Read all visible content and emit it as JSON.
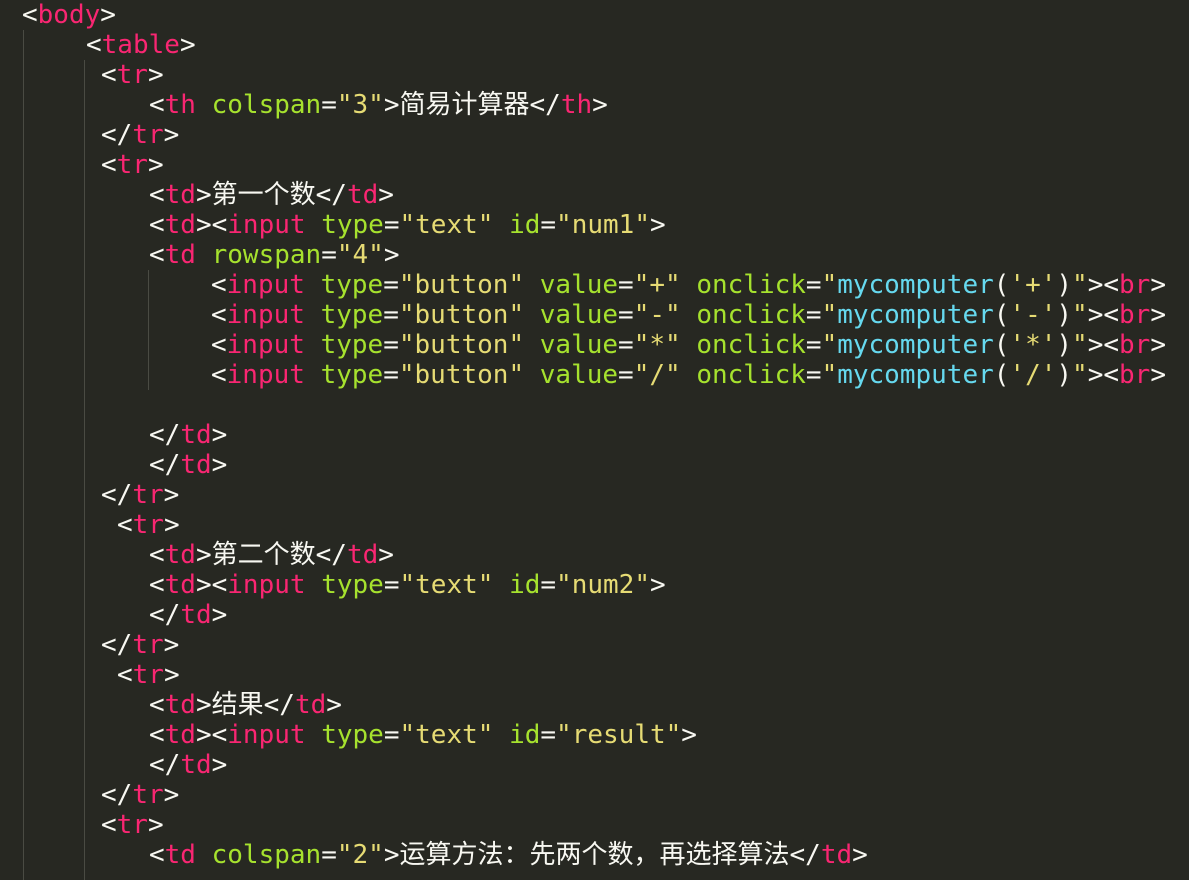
{
  "editor": {
    "colors": {
      "background": "#272822",
      "tag": "#f92672",
      "attribute": "#a6e22e",
      "string": "#e6db74",
      "function": "#66d9ef",
      "punctuation": "#f8f8f2"
    },
    "lines": [
      {
        "tokens": [
          {
            "k": "p",
            "v": "<"
          },
          {
            "k": "t",
            "v": "body"
          },
          {
            "k": "p",
            "v": ">"
          }
        ]
      },
      {
        "tokens": [
          {
            "k": "p",
            "v": "<"
          },
          {
            "k": "t",
            "v": "table"
          },
          {
            "k": "p",
            "v": ">"
          }
        ]
      },
      {
        "tokens": [
          {
            "k": "p",
            "v": "<"
          },
          {
            "k": "t",
            "v": "tr"
          },
          {
            "k": "p",
            "v": ">"
          }
        ]
      },
      {
        "tokens": [
          {
            "k": "p",
            "v": "<"
          },
          {
            "k": "t",
            "v": "th"
          },
          {
            "k": "p",
            "v": " "
          },
          {
            "k": "a",
            "v": "colspan"
          },
          {
            "k": "p",
            "v": "="
          },
          {
            "k": "s",
            "v": "\"3\""
          },
          {
            "k": "p",
            "v": ">"
          },
          {
            "k": "x",
            "v": "简易计算器"
          },
          {
            "k": "p",
            "v": "</"
          },
          {
            "k": "t",
            "v": "th"
          },
          {
            "k": "p",
            "v": ">"
          }
        ]
      },
      {
        "tokens": [
          {
            "k": "p",
            "v": "</"
          },
          {
            "k": "t",
            "v": "tr"
          },
          {
            "k": "p",
            "v": ">"
          }
        ]
      },
      {
        "tokens": [
          {
            "k": "p",
            "v": "<"
          },
          {
            "k": "t",
            "v": "tr"
          },
          {
            "k": "p",
            "v": ">"
          }
        ]
      },
      {
        "tokens": [
          {
            "k": "p",
            "v": "<"
          },
          {
            "k": "t",
            "v": "td"
          },
          {
            "k": "p",
            "v": ">"
          },
          {
            "k": "x",
            "v": "第一个数"
          },
          {
            "k": "p",
            "v": "</"
          },
          {
            "k": "t",
            "v": "td"
          },
          {
            "k": "p",
            "v": ">"
          }
        ]
      },
      {
        "tokens": [
          {
            "k": "p",
            "v": "<"
          },
          {
            "k": "t",
            "v": "td"
          },
          {
            "k": "p",
            "v": "><"
          },
          {
            "k": "t",
            "v": "input"
          },
          {
            "k": "p",
            "v": " "
          },
          {
            "k": "a",
            "v": "type"
          },
          {
            "k": "p",
            "v": "="
          },
          {
            "k": "s",
            "v": "\"text\""
          },
          {
            "k": "p",
            "v": " "
          },
          {
            "k": "a",
            "v": "id"
          },
          {
            "k": "p",
            "v": "="
          },
          {
            "k": "s",
            "v": "\"num1\""
          },
          {
            "k": "p",
            "v": ">"
          }
        ]
      },
      {
        "tokens": [
          {
            "k": "p",
            "v": "<"
          },
          {
            "k": "t",
            "v": "td"
          },
          {
            "k": "p",
            "v": " "
          },
          {
            "k": "a",
            "v": "rowspan"
          },
          {
            "k": "p",
            "v": "="
          },
          {
            "k": "s",
            "v": "\"4\""
          },
          {
            "k": "p",
            "v": ">"
          }
        ]
      },
      {
        "tokens": [
          {
            "k": "p",
            "v": "<"
          },
          {
            "k": "t",
            "v": "input"
          },
          {
            "k": "p",
            "v": " "
          },
          {
            "k": "a",
            "v": "type"
          },
          {
            "k": "p",
            "v": "="
          },
          {
            "k": "s",
            "v": "\"button\""
          },
          {
            "k": "p",
            "v": " "
          },
          {
            "k": "a",
            "v": "value"
          },
          {
            "k": "p",
            "v": "="
          },
          {
            "k": "s",
            "v": "\"+\""
          },
          {
            "k": "p",
            "v": " "
          },
          {
            "k": "a",
            "v": "onclick"
          },
          {
            "k": "p",
            "v": "="
          },
          {
            "k": "s",
            "v": "\""
          },
          {
            "k": "f",
            "v": "mycomputer"
          },
          {
            "k": "p",
            "v": "("
          },
          {
            "k": "s",
            "v": "'+'"
          },
          {
            "k": "p",
            "v": ")"
          },
          {
            "k": "s",
            "v": "\""
          },
          {
            "k": "p",
            "v": "><"
          },
          {
            "k": "t",
            "v": "br"
          },
          {
            "k": "p",
            "v": ">"
          }
        ]
      },
      {
        "tokens": [
          {
            "k": "p",
            "v": "<"
          },
          {
            "k": "t",
            "v": "input"
          },
          {
            "k": "p",
            "v": " "
          },
          {
            "k": "a",
            "v": "type"
          },
          {
            "k": "p",
            "v": "="
          },
          {
            "k": "s",
            "v": "\"button\""
          },
          {
            "k": "p",
            "v": " "
          },
          {
            "k": "a",
            "v": "value"
          },
          {
            "k": "p",
            "v": "="
          },
          {
            "k": "s",
            "v": "\"-\""
          },
          {
            "k": "p",
            "v": " "
          },
          {
            "k": "a",
            "v": "onclick"
          },
          {
            "k": "p",
            "v": "="
          },
          {
            "k": "s",
            "v": "\""
          },
          {
            "k": "f",
            "v": "mycomputer"
          },
          {
            "k": "p",
            "v": "("
          },
          {
            "k": "s",
            "v": "'-'"
          },
          {
            "k": "p",
            "v": ")"
          },
          {
            "k": "s",
            "v": "\""
          },
          {
            "k": "p",
            "v": "><"
          },
          {
            "k": "t",
            "v": "br"
          },
          {
            "k": "p",
            "v": ">"
          }
        ]
      },
      {
        "tokens": [
          {
            "k": "p",
            "v": "<"
          },
          {
            "k": "t",
            "v": "input"
          },
          {
            "k": "p",
            "v": " "
          },
          {
            "k": "a",
            "v": "type"
          },
          {
            "k": "p",
            "v": "="
          },
          {
            "k": "s",
            "v": "\"button\""
          },
          {
            "k": "p",
            "v": " "
          },
          {
            "k": "a",
            "v": "value"
          },
          {
            "k": "p",
            "v": "="
          },
          {
            "k": "s",
            "v": "\"*\""
          },
          {
            "k": "p",
            "v": " "
          },
          {
            "k": "a",
            "v": "onclick"
          },
          {
            "k": "p",
            "v": "="
          },
          {
            "k": "s",
            "v": "\""
          },
          {
            "k": "f",
            "v": "mycomputer"
          },
          {
            "k": "p",
            "v": "("
          },
          {
            "k": "s",
            "v": "'*'"
          },
          {
            "k": "p",
            "v": ")"
          },
          {
            "k": "s",
            "v": "\""
          },
          {
            "k": "p",
            "v": "><"
          },
          {
            "k": "t",
            "v": "br"
          },
          {
            "k": "p",
            "v": ">"
          }
        ]
      },
      {
        "tokens": [
          {
            "k": "p",
            "v": "<"
          },
          {
            "k": "t",
            "v": "input"
          },
          {
            "k": "p",
            "v": " "
          },
          {
            "k": "a",
            "v": "type"
          },
          {
            "k": "p",
            "v": "="
          },
          {
            "k": "s",
            "v": "\"button\""
          },
          {
            "k": "p",
            "v": " "
          },
          {
            "k": "a",
            "v": "value"
          },
          {
            "k": "p",
            "v": "="
          },
          {
            "k": "s",
            "v": "\"/\""
          },
          {
            "k": "p",
            "v": " "
          },
          {
            "k": "a",
            "v": "onclick"
          },
          {
            "k": "p",
            "v": "="
          },
          {
            "k": "s",
            "v": "\""
          },
          {
            "k": "f",
            "v": "mycomputer"
          },
          {
            "k": "p",
            "v": "("
          },
          {
            "k": "s",
            "v": "'/'"
          },
          {
            "k": "p",
            "v": ")"
          },
          {
            "k": "s",
            "v": "\""
          },
          {
            "k": "p",
            "v": "><"
          },
          {
            "k": "t",
            "v": "br"
          },
          {
            "k": "p",
            "v": ">"
          }
        ]
      },
      {
        "tokens": []
      },
      {
        "tokens": [
          {
            "k": "p",
            "v": "</"
          },
          {
            "k": "t",
            "v": "td"
          },
          {
            "k": "p",
            "v": ">"
          }
        ]
      },
      {
        "tokens": [
          {
            "k": "p",
            "v": "</"
          },
          {
            "k": "t",
            "v": "td"
          },
          {
            "k": "p",
            "v": ">"
          }
        ]
      },
      {
        "tokens": [
          {
            "k": "p",
            "v": "</"
          },
          {
            "k": "t",
            "v": "tr"
          },
          {
            "k": "p",
            "v": ">"
          }
        ]
      },
      {
        "tokens": [
          {
            "k": "p",
            "v": "<"
          },
          {
            "k": "t",
            "v": "tr"
          },
          {
            "k": "p",
            "v": ">"
          }
        ]
      },
      {
        "tokens": [
          {
            "k": "p",
            "v": "<"
          },
          {
            "k": "t",
            "v": "td"
          },
          {
            "k": "p",
            "v": ">"
          },
          {
            "k": "x",
            "v": "第二个数"
          },
          {
            "k": "p",
            "v": "</"
          },
          {
            "k": "t",
            "v": "td"
          },
          {
            "k": "p",
            "v": ">"
          }
        ]
      },
      {
        "tokens": [
          {
            "k": "p",
            "v": "<"
          },
          {
            "k": "t",
            "v": "td"
          },
          {
            "k": "p",
            "v": "><"
          },
          {
            "k": "t",
            "v": "input"
          },
          {
            "k": "p",
            "v": " "
          },
          {
            "k": "a",
            "v": "type"
          },
          {
            "k": "p",
            "v": "="
          },
          {
            "k": "s",
            "v": "\"text\""
          },
          {
            "k": "p",
            "v": " "
          },
          {
            "k": "a",
            "v": "id"
          },
          {
            "k": "p",
            "v": "="
          },
          {
            "k": "s",
            "v": "\"num2\""
          },
          {
            "k": "p",
            "v": ">"
          }
        ]
      },
      {
        "tokens": [
          {
            "k": "p",
            "v": "</"
          },
          {
            "k": "t",
            "v": "td"
          },
          {
            "k": "p",
            "v": ">"
          }
        ]
      },
      {
        "tokens": [
          {
            "k": "p",
            "v": "</"
          },
          {
            "k": "t",
            "v": "tr"
          },
          {
            "k": "p",
            "v": ">"
          }
        ]
      },
      {
        "tokens": [
          {
            "k": "p",
            "v": "<"
          },
          {
            "k": "t",
            "v": "tr"
          },
          {
            "k": "p",
            "v": ">"
          }
        ]
      },
      {
        "tokens": [
          {
            "k": "p",
            "v": "<"
          },
          {
            "k": "t",
            "v": "td"
          },
          {
            "k": "p",
            "v": ">"
          },
          {
            "k": "x",
            "v": "结果"
          },
          {
            "k": "p",
            "v": "</"
          },
          {
            "k": "t",
            "v": "td"
          },
          {
            "k": "p",
            "v": ">"
          }
        ]
      },
      {
        "tokens": [
          {
            "k": "p",
            "v": "<"
          },
          {
            "k": "t",
            "v": "td"
          },
          {
            "k": "p",
            "v": "><"
          },
          {
            "k": "t",
            "v": "input"
          },
          {
            "k": "p",
            "v": " "
          },
          {
            "k": "a",
            "v": "type"
          },
          {
            "k": "p",
            "v": "="
          },
          {
            "k": "s",
            "v": "\"text\""
          },
          {
            "k": "p",
            "v": " "
          },
          {
            "k": "a",
            "v": "id"
          },
          {
            "k": "p",
            "v": "="
          },
          {
            "k": "s",
            "v": "\"result\""
          },
          {
            "k": "p",
            "v": ">"
          }
        ]
      },
      {
        "tokens": [
          {
            "k": "p",
            "v": "</"
          },
          {
            "k": "t",
            "v": "td"
          },
          {
            "k": "p",
            "v": ">"
          }
        ]
      },
      {
        "tokens": [
          {
            "k": "p",
            "v": "</"
          },
          {
            "k": "t",
            "v": "tr"
          },
          {
            "k": "p",
            "v": ">"
          }
        ]
      },
      {
        "tokens": [
          {
            "k": "p",
            "v": "<"
          },
          {
            "k": "t",
            "v": "tr"
          },
          {
            "k": "p",
            "v": ">"
          }
        ]
      },
      {
        "tokens": [
          {
            "k": "p",
            "v": "<"
          },
          {
            "k": "t",
            "v": "td"
          },
          {
            "k": "p",
            "v": " "
          },
          {
            "k": "a",
            "v": "colspan"
          },
          {
            "k": "p",
            "v": "="
          },
          {
            "k": "s",
            "v": "\"2\""
          },
          {
            "k": "p",
            "v": ">"
          },
          {
            "k": "x",
            "v": "运算方法：先两个数，再选择算法"
          },
          {
            "k": "p",
            "v": "</"
          },
          {
            "k": "t",
            "v": "td"
          },
          {
            "k": "p",
            "v": ">"
          }
        ]
      }
    ]
  }
}
